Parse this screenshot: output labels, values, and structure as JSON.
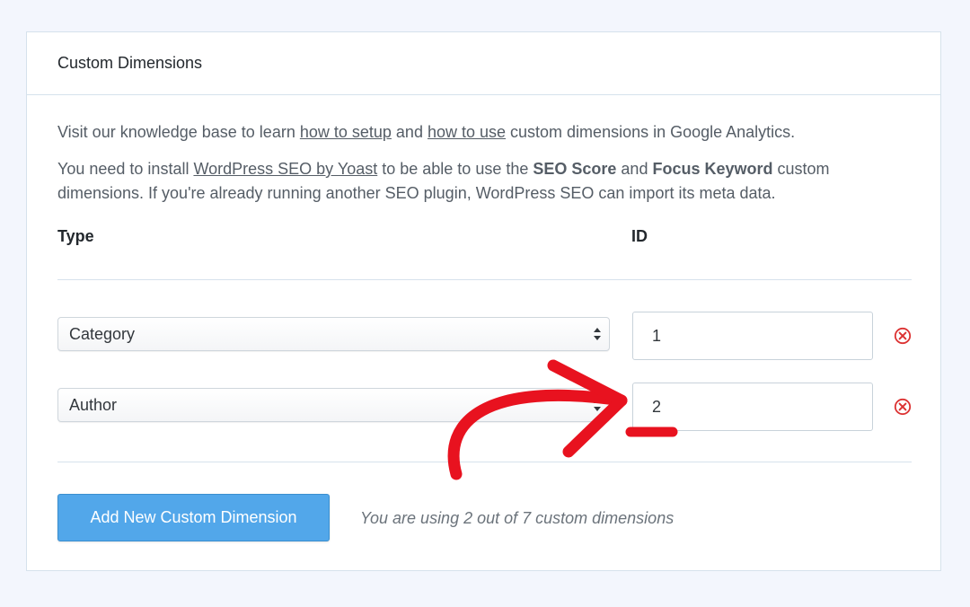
{
  "panel": {
    "title": "Custom Dimensions"
  },
  "intro": {
    "p1_prefix": "Visit our knowledge base to learn ",
    "p1_link_setup": "how to setup",
    "p1_middle": " and ",
    "p1_link_use": "how to use",
    "p1_suffix": " custom dimensions in Google Analytics.",
    "p2_prefix": "You need to install ",
    "p2_link_plugin": "WordPress SEO by Yoast",
    "p2_middle1": " to be able to use the ",
    "p2_bold1": "SEO Score",
    "p2_middle2": " and ",
    "p2_bold2": "Focus Keyword",
    "p2_suffix": " custom dimensions. If you're already running another SEO plugin, WordPress SEO can import its meta data."
  },
  "table": {
    "col_type": "Type",
    "col_id": "ID",
    "rows": [
      {
        "type": "Category",
        "id": "1"
      },
      {
        "type": "Author",
        "id": "2"
      }
    ]
  },
  "footer": {
    "add_button_label": "Add New Custom Dimension",
    "usage_text": "You are using 2 out of 7 custom dimensions"
  },
  "colors": {
    "accent_button": "#52a7ea",
    "remove_icon": "#dc3232",
    "annotation_arrow": "#e8121f"
  },
  "icons": {
    "remove": "remove-circle-icon",
    "select": "select-arrows-icon"
  }
}
